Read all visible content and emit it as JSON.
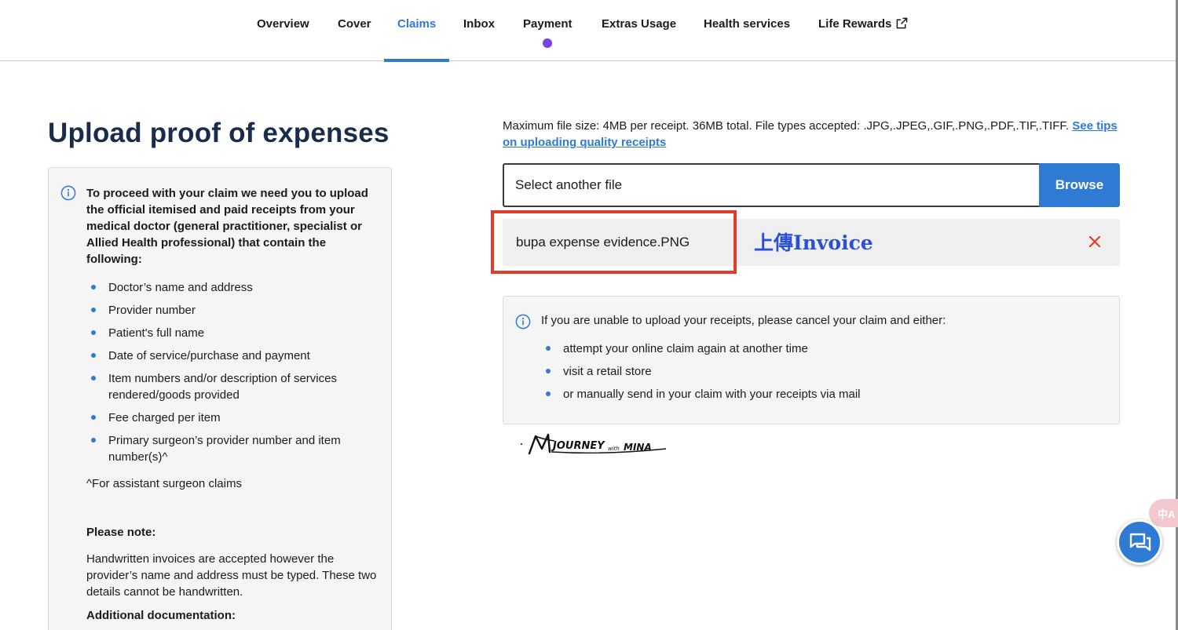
{
  "nav": {
    "items": [
      {
        "label": "Overview"
      },
      {
        "label": "Cover"
      },
      {
        "label": "Claims"
      },
      {
        "label": "Inbox"
      },
      {
        "label": "Payment"
      },
      {
        "label": "Extras Usage"
      },
      {
        "label": "Health services"
      },
      {
        "label": "Life Rewards"
      }
    ],
    "active": "Claims",
    "accent_color": "#2f7bd3",
    "notification_dot_color": "#7b3fe4"
  },
  "page": {
    "title": "Upload proof of expenses"
  },
  "requirements": {
    "intro": "To proceed with your claim we need you to upload the official itemised and paid receipts from your medical doctor (general practitioner, specialist or Allied Health professional) that contain the following:",
    "items": [
      "Doctor’s name and address",
      "Provider number",
      "Patient's full name",
      "Date of service/purchase and payment",
      "Item numbers and/or description of services rendered/goods provided",
      "Fee charged per item",
      "Primary surgeon’s provider number and item number(s)^"
    ],
    "footnote": "^For assistant surgeon claims",
    "note_heading": "Please note:",
    "note_text": "Handwritten invoices are accepted however the provider’s name and address must be typed. These two details cannot be handwritten.",
    "docs_heading": "Additional documentation:"
  },
  "upload": {
    "info_text": "Maximum file size: 4MB per receipt. 36MB total. File types accepted: .JPG,.JPEG,.GIF,.PNG,.PDF,.TIF,.TIFF.",
    "tips_link": "See tips on uploading quality receipts",
    "input_value": "Select another file",
    "browse_label": "Browse",
    "file_name": "bupa expense evidence.PNG",
    "annotation": "上傳Invoice"
  },
  "help": {
    "intro": "If you are unable to upload your receipts, please cancel your claim and either:",
    "items": [
      "attempt your online claim again at another time",
      "visit a retail store",
      "or manually send in your claim with your receipts via mail"
    ]
  },
  "widgets": {
    "translate_glyph": "中A",
    "watermark_text": "JOURNEY with MINA"
  },
  "icons": {
    "info": "info-circle-icon",
    "remove": "close-x-icon",
    "external": "external-link-icon",
    "chat": "chat-bubbles-icon",
    "translate": "translate-icon"
  }
}
